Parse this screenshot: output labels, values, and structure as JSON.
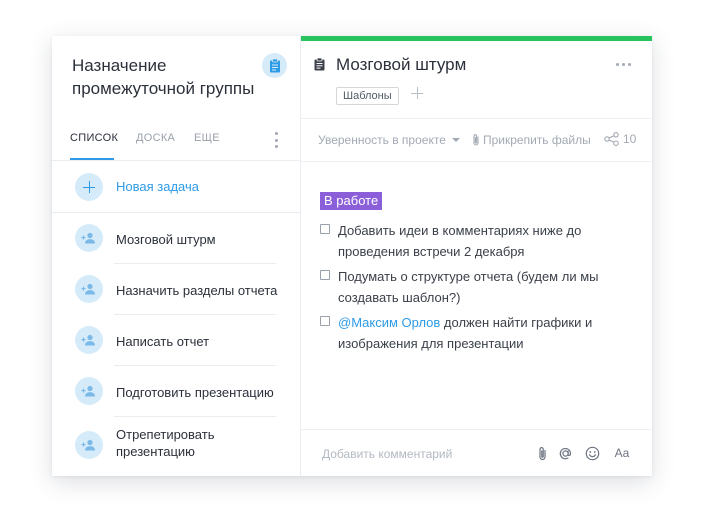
{
  "project": {
    "title": "Назначение промежуточной группы"
  },
  "tabs": [
    {
      "label": "СПИСОК",
      "active": true
    },
    {
      "label": "ДОСКА",
      "active": false
    },
    {
      "label": "ЕЩЕ",
      "active": false
    }
  ],
  "new_task_label": "Новая задача",
  "tasks": [
    {
      "label": "Мозговой штурм"
    },
    {
      "label": "Назначить разделы отчета"
    },
    {
      "label": "Написать отчет"
    },
    {
      "label": "Подготовить презентацию"
    },
    {
      "label": "Отрепетировать презентацию"
    }
  ],
  "task_detail": {
    "title": "Мозговой штурм",
    "tag": "Шаблоны",
    "toolbar": {
      "confidence": "Уверенность в проекте",
      "attach": "Прикрепить файлы",
      "share_count": "10"
    },
    "status": "В работе",
    "status_color": "#8b5fd9",
    "checklist": [
      {
        "text": "Добавить идеи в комментариях ниже до проведения встречи 2 декабря"
      },
      {
        "text": "Подумать о структуре отчета (будем ли мы создавать шаблон?)"
      },
      {
        "mention": "@Максим Орлов",
        "text": " должен найти графики и изображения для презентации"
      }
    ],
    "comment_placeholder": "Добавить комментарий",
    "format_label": "Aa"
  },
  "colors": {
    "accent": "#2d9be6",
    "progress": "#28c35d"
  }
}
